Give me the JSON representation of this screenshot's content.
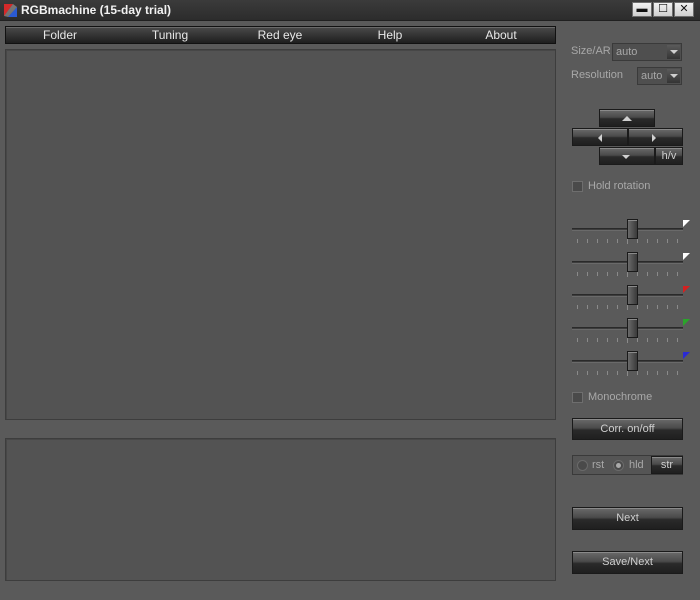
{
  "window": {
    "title": "RGBmachine (15-day trial)",
    "controls": {
      "minimize": "▬",
      "maximize": "☐",
      "close": "✕"
    }
  },
  "menu": {
    "items": [
      "Folder",
      "Tuning",
      "Red eye",
      "Help",
      "About"
    ]
  },
  "controls": {
    "size_ar_label": "Size/AR",
    "size_ar_value": "auto",
    "resolution_label": "Resolution",
    "resolution_value": "auto",
    "hv_label": "h/v",
    "hold_rotation_label": "Hold rotation",
    "monochrome_label": "Monochrome",
    "corr_button": "Corr. on/off",
    "mode_rst": "rst",
    "mode_hld": "hld",
    "mode_selected": "hld",
    "str_button": "str",
    "next_button": "Next",
    "save_next_button": "Save/Next"
  },
  "sliders": [
    {
      "name": "brightness",
      "color": "#ffffff",
      "value": 0.5
    },
    {
      "name": "contrast",
      "color": "#ffffff",
      "value": 0.5
    },
    {
      "name": "red",
      "color": "#d42020",
      "value": 0.5
    },
    {
      "name": "green",
      "color": "#2aa52a",
      "value": 0.5
    },
    {
      "name": "blue",
      "color": "#2a2ad4",
      "value": 0.5
    }
  ],
  "colors": {
    "background": "#5a5a5a",
    "panel": "#535353",
    "titlebar": "#2c2c2c"
  },
  "icons": [
    "app-logo-icon",
    "minimize-icon",
    "maximize-icon",
    "close-icon",
    "arrow-up-icon",
    "arrow-left-icon",
    "arrow-right-icon",
    "arrow-down-icon"
  ]
}
